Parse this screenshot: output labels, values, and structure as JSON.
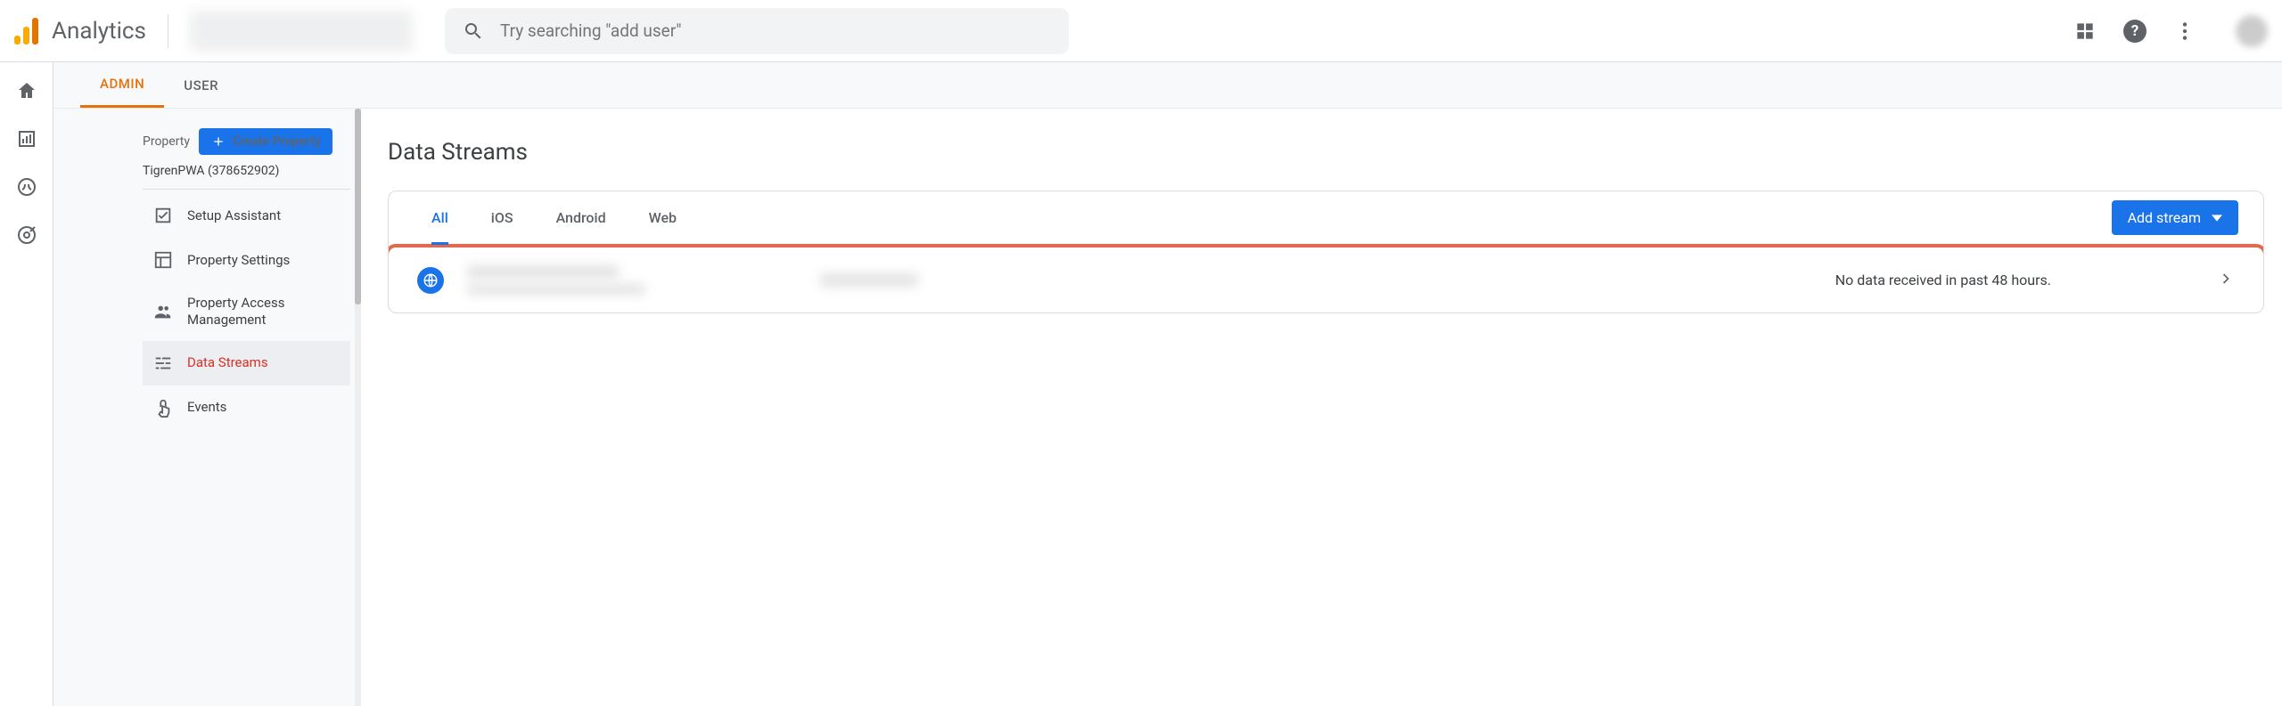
{
  "header": {
    "app_name": "Analytics",
    "search_placeholder": "Try searching \"add user\""
  },
  "tabs": {
    "admin": "ADMIN",
    "user": "USER"
  },
  "property": {
    "section_label": "Property",
    "create_btn": "Create Property",
    "selected": "TigrenPWA (378652902)",
    "nav": {
      "setup_assistant": "Setup Assistant",
      "property_settings": "Property Settings",
      "access_mgmt": "Property Access Management",
      "data_streams": "Data Streams",
      "events": "Events"
    }
  },
  "main": {
    "title": "Data Streams",
    "stream_tabs": {
      "all": "All",
      "ios": "iOS",
      "android": "Android",
      "web": "Web"
    },
    "add_stream_btn": "Add stream",
    "row_status": "No data received in past 48 hours."
  }
}
